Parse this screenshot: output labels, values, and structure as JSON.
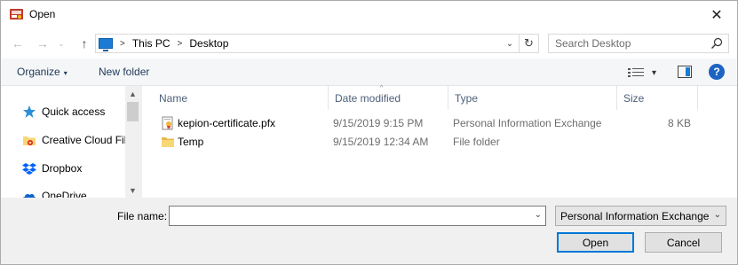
{
  "window": {
    "title": "Open",
    "close_glyph": "✕",
    "app_icon": "certificate-app-icon"
  },
  "nav": {
    "back_glyph": "←",
    "forward_glyph": "→",
    "recent_glyph": "⌄",
    "up_glyph": "↑",
    "breadcrumb": [
      "This PC",
      "Desktop"
    ],
    "crumb_sep": ">",
    "address_dropdown_glyph": "⌄",
    "refresh_glyph": "↻",
    "search_placeholder": "Search Desktop"
  },
  "toolbar": {
    "organize_label": "Organize",
    "organize_caret": "▾",
    "new_folder_label": "New folder",
    "view_caret": "▾",
    "help_label": "?"
  },
  "nav_pane": {
    "items": [
      {
        "label": "Quick access",
        "icon": "star-icon"
      },
      {
        "label": "Creative Cloud Fil",
        "icon": "creative-cloud-folder-icon"
      },
      {
        "label": "Dropbox",
        "icon": "dropbox-icon"
      },
      {
        "label": "OneDrive",
        "icon": "onedrive-icon"
      }
    ],
    "scroll_up_glyph": "▲",
    "scroll_down_glyph": "▼"
  },
  "file_list": {
    "columns": [
      "Name",
      "Date modified",
      "Type",
      "Size"
    ],
    "sort_indicator": "^",
    "rows": [
      {
        "name": "kepion-certificate.pfx",
        "date": "9/15/2019 9:15 PM",
        "type": "Personal Information Exchange",
        "size": "8 KB",
        "icon": "certificate-file-icon"
      },
      {
        "name": "Temp",
        "date": "9/15/2019 12:34 AM",
        "type": "File folder",
        "size": "",
        "icon": "folder-icon"
      }
    ]
  },
  "bottom": {
    "file_name_label": "File name:",
    "file_name_value": "",
    "file_name_dropdown_glyph": "⌄",
    "file_type_selected": "Personal Information Exchange",
    "file_type_dropdown_glyph": "⌄",
    "open_label": "Open",
    "cancel_label": "Cancel"
  },
  "colors": {
    "accent": "#0078d7",
    "folder": "#f8d775",
    "toolbar_text": "#1e395b",
    "header_text": "#4c607a"
  }
}
